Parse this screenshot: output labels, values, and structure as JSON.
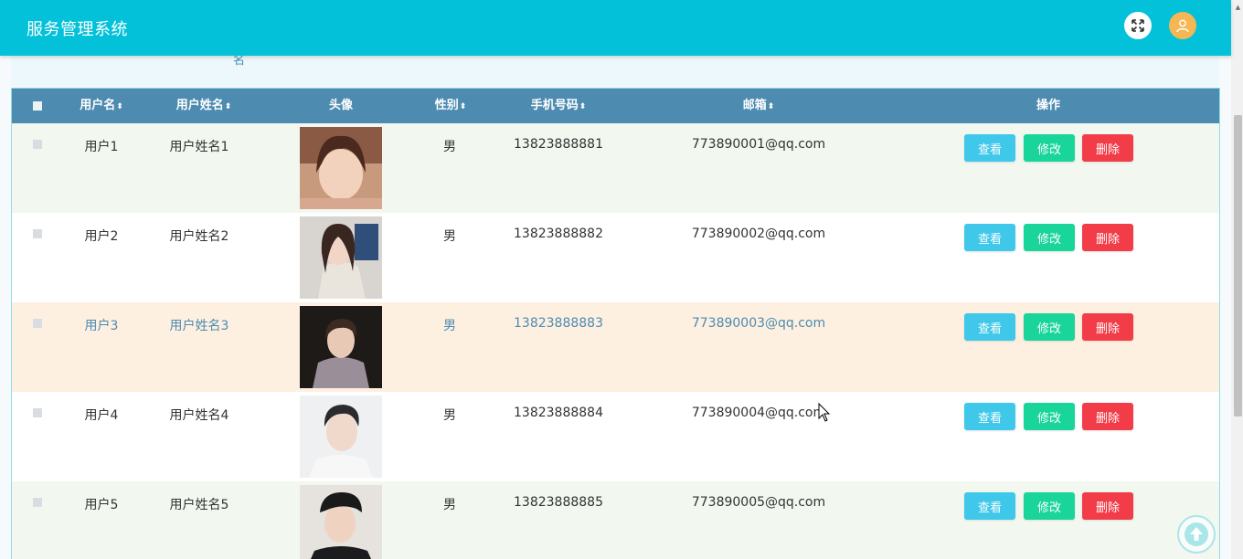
{
  "app": {
    "title": "服务管理系统"
  },
  "search_fragment": "名",
  "table": {
    "headers": {
      "username": "用户名",
      "fullname": "用户姓名",
      "avatar": "头像",
      "gender": "性别",
      "phone": "手机号码",
      "email": "邮箱",
      "actions": "操作"
    },
    "sort_glyph": "⬍",
    "rows": [
      {
        "username": "用户1",
        "fullname": "用户姓名1",
        "gender": "男",
        "phone": "13823888881",
        "email": "773890001@qq.com"
      },
      {
        "username": "用户2",
        "fullname": "用户姓名2",
        "gender": "男",
        "phone": "13823888882",
        "email": "773890002@qq.com"
      },
      {
        "username": "用户3",
        "fullname": "用户姓名3",
        "gender": "男",
        "phone": "13823888883",
        "email": "773890003@qq.com"
      },
      {
        "username": "用户4",
        "fullname": "用户姓名4",
        "gender": "男",
        "phone": "13823888884",
        "email": "773890004@qq.com"
      },
      {
        "username": "用户5",
        "fullname": "用户姓名5",
        "gender": "男",
        "phone": "13823888885",
        "email": "773890005@qq.com"
      }
    ],
    "buttons": {
      "view": "查看",
      "edit": "修改",
      "delete": "删除"
    }
  },
  "colors": {
    "topbar": "#02c1d9",
    "table_header": "#4d8bb0",
    "view_button": "#3fc8ea",
    "edit_button": "#1ad59a",
    "delete_button": "#f23c48",
    "hover_row": "#fdf0e1"
  },
  "icons": {
    "fullscreen": "fullscreen-icon",
    "user": "user-icon",
    "back_to_top": "arrow-up-icon"
  }
}
